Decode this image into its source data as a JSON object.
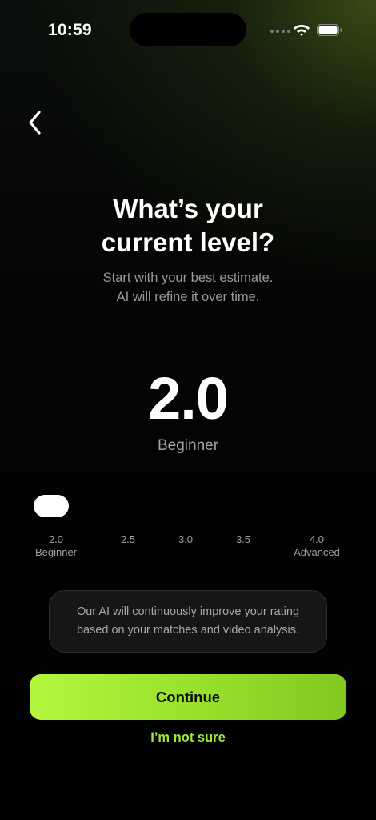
{
  "status_bar": {
    "time": "10:59"
  },
  "header": {
    "title": "What’s your\ncurrent level?",
    "subtitle": "Start with your best estimate.\nAI will refine it over time."
  },
  "level": {
    "value": "2.0",
    "label": "Beginner",
    "slider_position": 0.0
  },
  "slider": {
    "ticks": [
      {
        "value": "2.0",
        "sub": "Beginner"
      },
      {
        "value": "2.5",
        "sub": ""
      },
      {
        "value": "3.0",
        "sub": ""
      },
      {
        "value": "3.5",
        "sub": ""
      },
      {
        "value": "4.0",
        "sub": "Advanced"
      }
    ]
  },
  "info": {
    "text": "Our AI will continuously improve your rating based on your matches and video analysis."
  },
  "actions": {
    "continue_label": "Continue",
    "not_sure_label": "I’m not sure"
  },
  "colors": {
    "accent": "#9fe63a",
    "button_start": "#b4f63e",
    "button_end": "#82c81f"
  },
  "icons": {
    "back": "chevron-left-icon",
    "wifi": "wifi-icon",
    "battery": "battery-icon"
  }
}
